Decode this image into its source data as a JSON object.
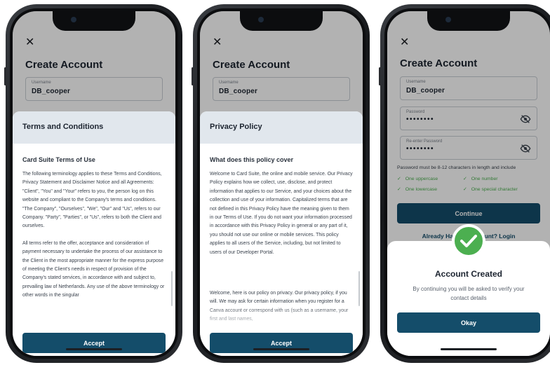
{
  "form": {
    "close_glyph": "✕",
    "title": "Create Account",
    "username_label": "Username",
    "username_value": "DB_cooper",
    "password_label": "Password",
    "password_value": "••••••••",
    "reenter_label": "Re-enter Password",
    "reenter_value": "••••••••"
  },
  "terms": {
    "header": "Terms and Conditions",
    "subtitle": "Card Suite Terms of Use",
    "para1": "The following terminology applies to these Terms and Conditions, Privacy Statement and Disclaimer Notice and all Agreements: \"Client\", \"You\" and \"Your\" refers to you, the person log on this website and compliant to the Company's terms and conditions. \"The Company\", \"Ourselves\", \"We\", \"Our\" and \"Us\", refers to our Company. \"Party\", \"Parties\", or \"Us\", refers to both the Client and ourselves.",
    "para2": "All terms refer to the offer, acceptance and consideration of payment necessary to undertake the process of our assistance to the Client in the most appropriate manner for the express purpose of meeting the Client's needs in respect of provision of the Company's stated services, in accordance with and subject to, prevailing law of Netherlands. Any use of the above terminology or other words in the singular",
    "button": "Accept"
  },
  "privacy": {
    "header": "Privacy Policy",
    "subtitle": "What does this policy cover",
    "para1": "Welcome to Card Suite, the online and mobile service. Our Privacy Policy explains how we collect, use, disclose, and protect information that applies to our Service, and your choices about the collection and use of your information. Capitalized terms that are not defined in this Privacy Policy have the meaning given to them in our Terms of Use. If you do not want your information processed in accordance with this Privacy Policy in general or any part of it, you should not use our online or mobile services. This policy applies to all users of the Service, including, but not limited to users of our Developer Portal.",
    "para2": "Welcome, here is our policy on privacy. Our privacy policy, if you will. We may ask for certain information when you register for a Canva account or correspond with us (such as a username, your first and last names,",
    "button": "Accept"
  },
  "created": {
    "hint": "Password must be 8-12 characters in length and include",
    "check_glyph": "✓",
    "checks": [
      "One uppercase",
      "One number",
      "One lowercase",
      "One special character"
    ],
    "continue_button": "Continue",
    "login_text": "Already Have an Account? Login",
    "modal_title": "Account Created",
    "modal_text": "By continuing you will be asked to verify your contact details",
    "ok_button": "Okay"
  },
  "colors": {
    "primary": "#144d6a",
    "success": "#4caf50",
    "sheet_header": "#e1e7ed"
  }
}
